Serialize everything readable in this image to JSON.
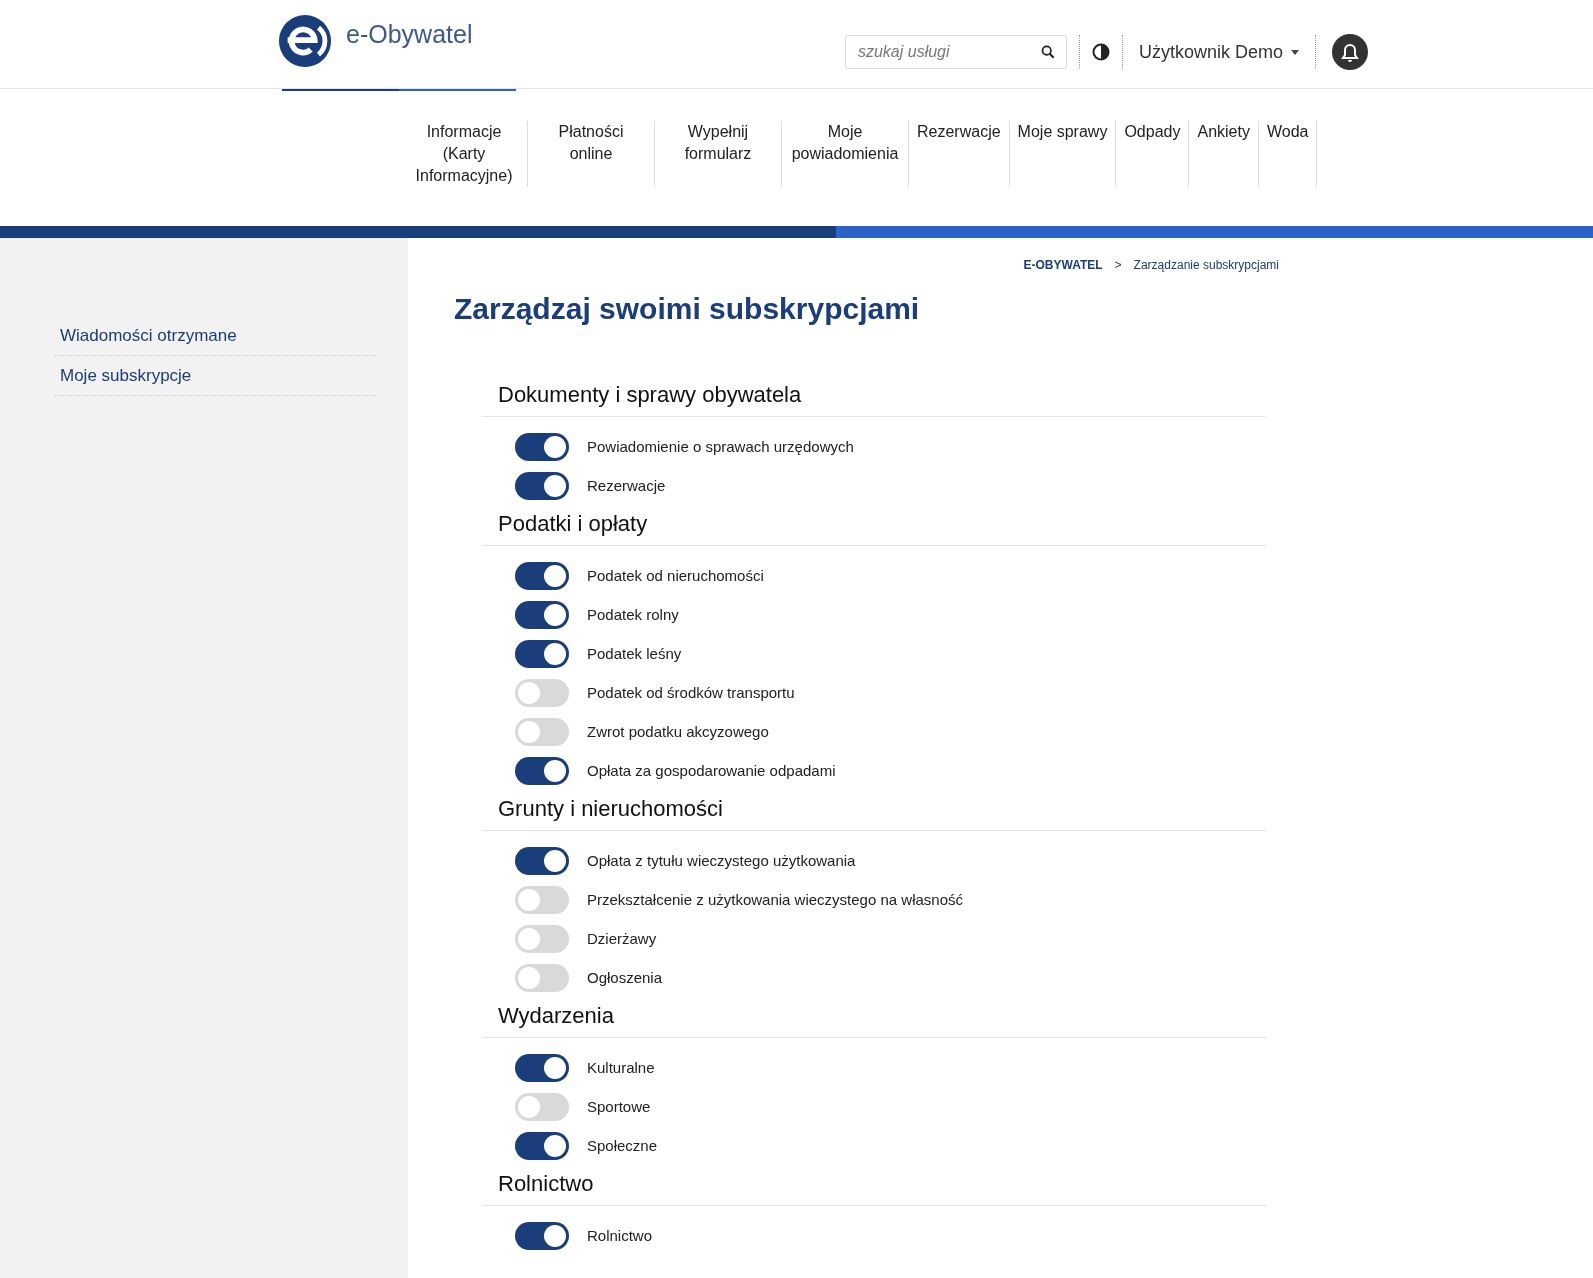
{
  "header": {
    "logo_text": "e-Obywatel",
    "search": {
      "placeholder": "szukaj usługi"
    },
    "user_menu": "Użytkownik Demo"
  },
  "nav": [
    {
      "label": "Informacje (Karty Informacyjne)"
    },
    {
      "label": "Płatności online"
    },
    {
      "label": "Wypełnij formularz"
    },
    {
      "label": "Moje powiadomienia"
    },
    {
      "label": "Rezerwacje"
    },
    {
      "label": "Moje sprawy"
    },
    {
      "label": "Odpady"
    },
    {
      "label": "Ankiety"
    },
    {
      "label": "Woda"
    }
  ],
  "sidebar": {
    "items": [
      {
        "label": "Wiadomości otrzymane"
      },
      {
        "label": "Moje subskrypcje"
      }
    ]
  },
  "breadcrumb": [
    "E-OBYWATEL",
    ">",
    "Zarządzanie subskrypcjami"
  ],
  "page_title": "Zarządzaj swoimi subskrypcjami",
  "sections": [
    {
      "title": "Dokumenty i sprawy obywatela",
      "items": [
        {
          "label": "Powiadomienie o sprawach urzędowych",
          "on": true
        },
        {
          "label": "Rezerwacje",
          "on": true
        }
      ]
    },
    {
      "title": "Podatki i opłaty",
      "items": [
        {
          "label": "Podatek od nieruchomości",
          "on": true
        },
        {
          "label": "Podatek rolny",
          "on": true
        },
        {
          "label": "Podatek leśny",
          "on": true
        },
        {
          "label": "Podatek od środków transportu",
          "on": false
        },
        {
          "label": "Zwrot podatku akcyzowego",
          "on": false
        },
        {
          "label": "Opłata za gospodarowanie odpadami",
          "on": true
        }
      ]
    },
    {
      "title": "Grunty i nieruchomości",
      "items": [
        {
          "label": "Opłata z tytułu wieczystego użytkowania",
          "on": true
        },
        {
          "label": "Przekształcenie z użytkowania wieczystego na własność",
          "on": false
        },
        {
          "label": "Dzierżawy",
          "on": false
        },
        {
          "label": "Ogłoszenia",
          "on": false
        }
      ]
    },
    {
      "title": "Wydarzenia",
      "items": [
        {
          "label": "Kulturalne",
          "on": true
        },
        {
          "label": "Sportowe",
          "on": false
        },
        {
          "label": "Społeczne",
          "on": true
        }
      ]
    },
    {
      "title": "Rolnictwo",
      "items": [
        {
          "label": "Rolnictwo",
          "on": true
        }
      ]
    }
  ]
}
